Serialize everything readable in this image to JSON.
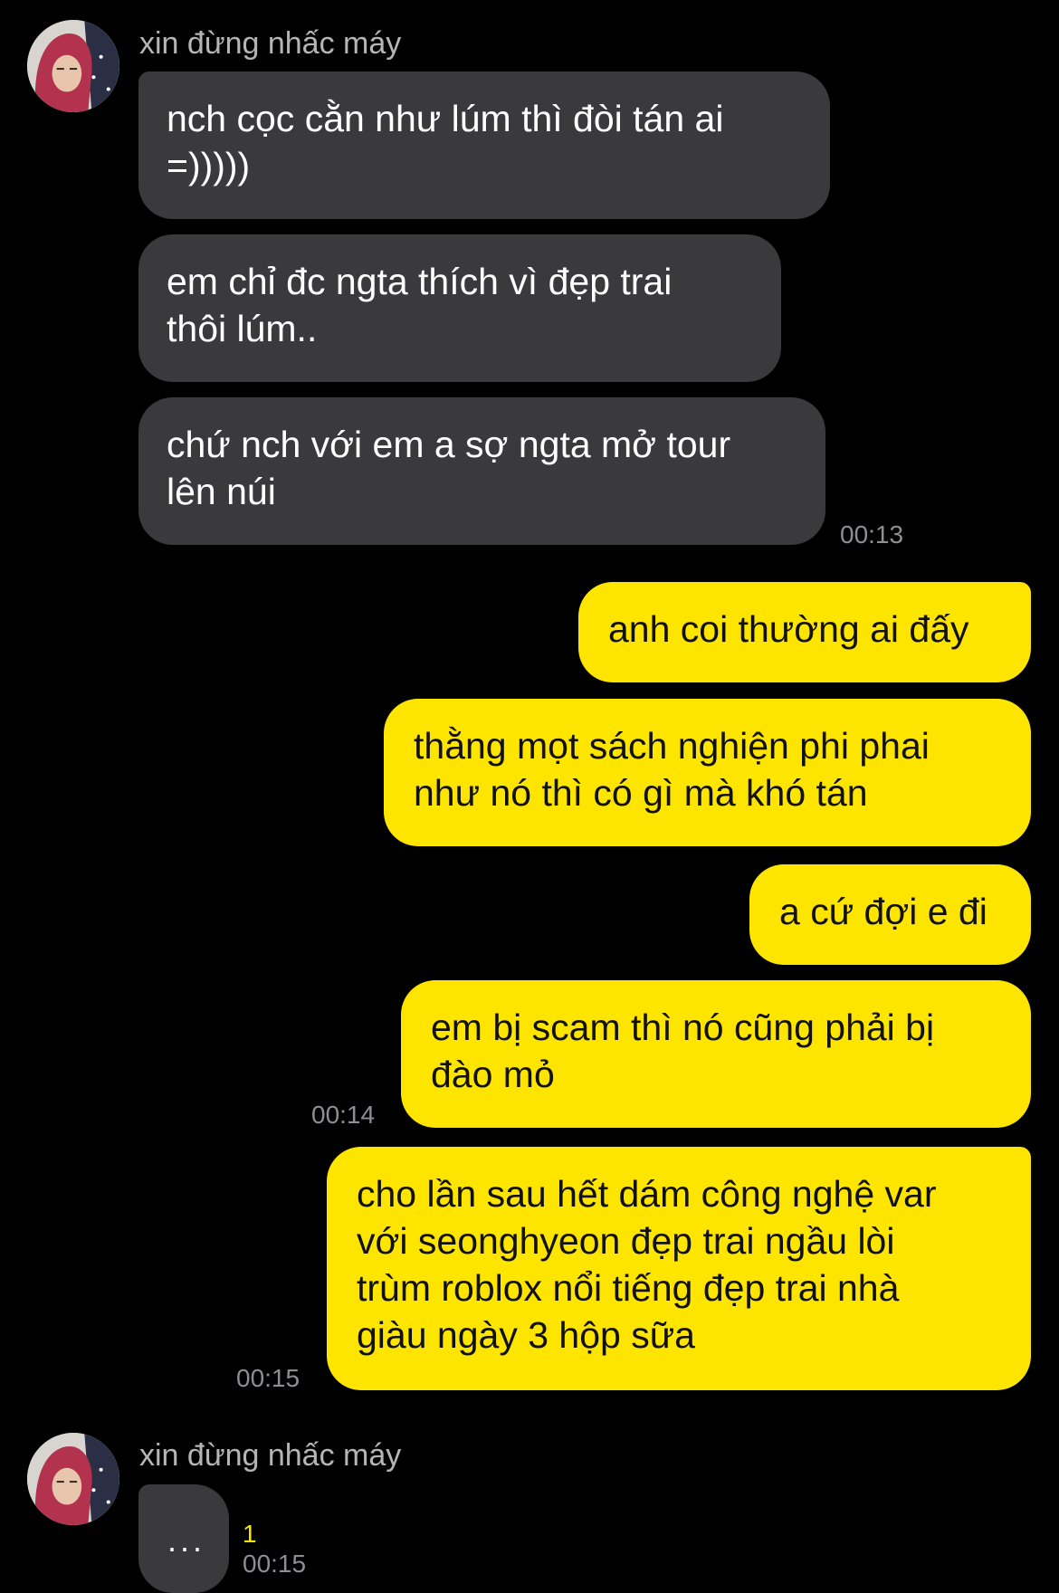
{
  "chat": {
    "contact_name": "xin đừng nhấc máy",
    "messages": [
      {
        "lines": [
          "nch cọc cằn như lúm thì đòi tán ai",
          "=)))))"
        ]
      },
      {
        "lines": [
          "em chỉ đc ngta thích vì đẹp trai",
          "thôi lúm.."
        ]
      },
      {
        "lines": [
          "chứ nch với em a sợ ngta mở tour",
          "lên núi"
        ],
        "time": "00:13"
      },
      {
        "lines": [
          "anh coi thường ai đấy"
        ]
      },
      {
        "lines": [
          "thằng mọt sách nghiện phi phai",
          "như nó thì có gì mà khó tán"
        ]
      },
      {
        "lines": [
          "a cứ đợi e đi"
        ]
      },
      {
        "lines": [
          "em bị scam thì nó cũng phải bị",
          "đào mỏ"
        ],
        "time": "00:14"
      },
      {
        "lines": [
          "cho lần sau hết dám công nghệ var",
          "với seonghyeon đẹp trai ngầu lòi",
          "trùm roblox nổi tiếng đẹp trai nhà",
          "giàu ngày 3 hộp sữa"
        ],
        "time": "00:15"
      },
      {
        "lines": [
          "..."
        ],
        "unread": "1",
        "time": "00:15"
      }
    ]
  },
  "colors": {
    "background": "#000000",
    "incoming_bubble": "#3a3a3c",
    "outgoing_bubble": "#fee500",
    "unread_count": "#fee500"
  }
}
